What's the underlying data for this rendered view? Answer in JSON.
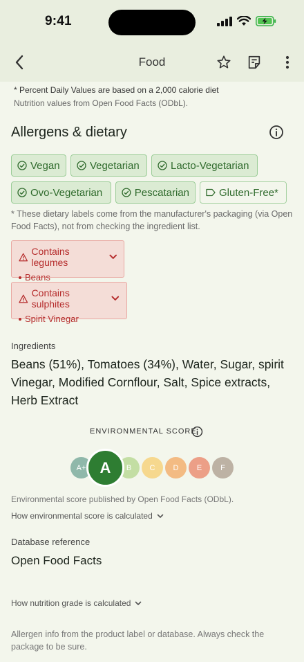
{
  "status": {
    "time": "9:41"
  },
  "header": {
    "title": "Food"
  },
  "notes": {
    "percent_daily": "* Percent Daily Values are based on a 2,000 calorie diet",
    "nutrition_source": "Nutrition values from Open Food Facts (ODbL)."
  },
  "allergens": {
    "title": "Allergens & dietary",
    "chips": [
      "Vegan",
      "Vegetarian",
      "Lacto-Vegetarian",
      "Ovo-Vegetarian",
      "Pescatarian",
      "Gluten-Free*"
    ],
    "disclaimer": "* These dietary labels come from the manufacturer's packaging (via Open Food Facts), not from checking the ingredient list.",
    "alerts": [
      {
        "label": "Contains legumes",
        "item": "Beans"
      },
      {
        "label": "Contains sulphites",
        "item": "Spirit Vinegar"
      }
    ]
  },
  "ingredients": {
    "label": "Ingredients",
    "text": "Beans (51%), Tomatoes (34%), Water, Sugar, spirit Vinegar, Modified Cornflour, Salt, Spice extracts, Herb Extract"
  },
  "env": {
    "title": "ENVIRONMENTAL SCORE",
    "grades": [
      "A+",
      "A",
      "B",
      "C",
      "D",
      "E",
      "F"
    ],
    "active": "A",
    "colors": {
      "A+": "#8fb8aa",
      "A": "#2e7d32",
      "B": "#c3dea4",
      "C": "#f6d88e",
      "D": "#f3bb83",
      "E": "#ec9f87",
      "F": "#bdb2a4"
    },
    "source": "Environmental score published by Open Food Facts (ODbL).",
    "how": "How environmental score is calculated"
  },
  "database": {
    "label": "Database reference",
    "value": "Open Food Facts"
  },
  "nutrition_grade": {
    "how": "How nutrition grade is calculated"
  },
  "footer": {
    "text": "Allergen info from the product label or database. Always check the package to be sure."
  },
  "colors": {
    "accent": "#2e7d32",
    "alert": "#b52b2b",
    "chip_bg": "#dbebd3"
  }
}
